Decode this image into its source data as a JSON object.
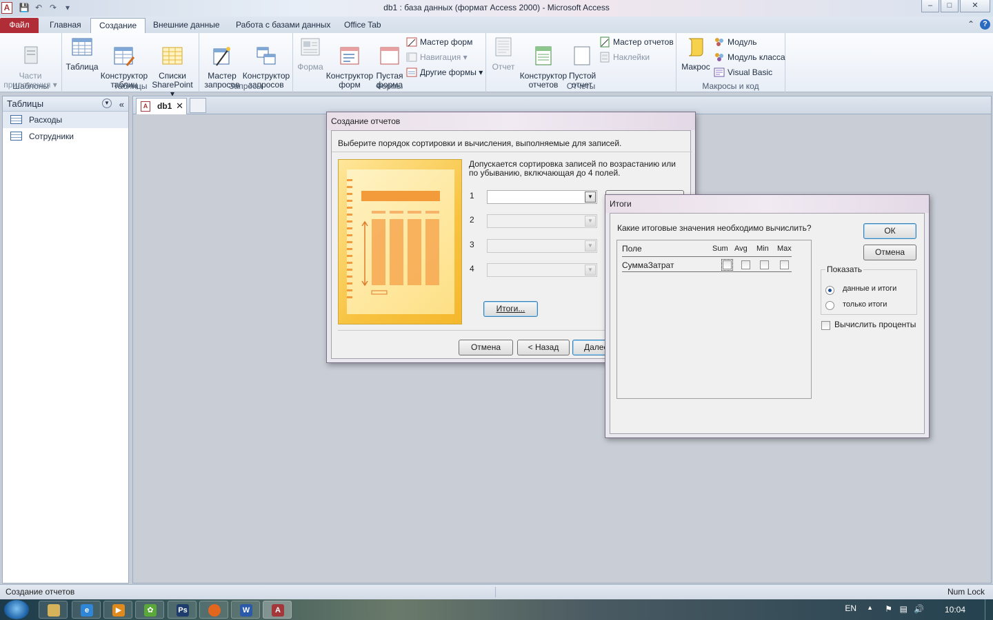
{
  "window": {
    "title": "db1 : база данных (формат Access 2000)  -  Microsoft Access"
  },
  "ribbon": {
    "tabs": [
      "Файл",
      "Главная",
      "Создание",
      "Внешние данные",
      "Работа с базами данных",
      "Office Tab"
    ],
    "groups": {
      "templates": {
        "label": "Шаблоны",
        "parts": "Части\nприложения"
      },
      "tables": {
        "label": "Таблицы",
        "table": "Таблица",
        "table_designer": "Конструктор\nтаблиц",
        "sharepoint": "Списки\nSharePoint"
      },
      "queries": {
        "label": "Запросы",
        "wizard": "Мастер\nзапросов",
        "designer": "Конструктор\nзапросов"
      },
      "forms": {
        "label": "Формы",
        "form": "Форма",
        "designer": "Конструктор\nформ",
        "blank": "Пустая\nформа",
        "wizard": "Мастер форм",
        "navigation": "Навигация",
        "other": "Другие формы"
      },
      "reports": {
        "label": "Отчеты",
        "report": "Отчет",
        "designer": "Конструктор\nотчетов",
        "blank": "Пустой\nотчет",
        "wizard": "Мастер отчетов",
        "labels": "Наклейки"
      },
      "macros": {
        "label": "Макросы и код",
        "macro": "Макрос",
        "module": "Модуль",
        "class_module": "Модуль класса",
        "vb": "Visual Basic"
      }
    }
  },
  "navpane": {
    "title": "Таблицы",
    "items": [
      {
        "label": "Расходы"
      },
      {
        "label": "Сотрудники"
      }
    ]
  },
  "doc_tab": {
    "label": "db1"
  },
  "wizard": {
    "title": "Создание отчетов",
    "instruction": "Выберите порядок сортировки и вычисления, выполняемые для записей.",
    "hint": "Допускается сортировка записей по возрастанию или по убыванию, включающая до 4 полей.",
    "rows": [
      "1",
      "2",
      "3",
      "4"
    ],
    "summary_button": "Итоги...",
    "cancel_button": "Отмена",
    "back_button": "< Назад",
    "next_button": "Далее"
  },
  "summary_dialog": {
    "title": "Итоги",
    "question": "Какие итоговые значения необходимо вычислить?",
    "columns": [
      "Поле",
      "Sum",
      "Avg",
      "Min",
      "Max"
    ],
    "rows": [
      {
        "field": "СуммаЗатрат"
      }
    ],
    "ok_button": "ОК",
    "cancel_button": "Отмена",
    "show_group": "Показать",
    "show_options": [
      "данные и итоги",
      "только итоги"
    ],
    "calc_percent": "Вычислить проценты"
  },
  "statusbar": {
    "left": "Создание отчетов",
    "right": "Num Lock"
  },
  "taskbar": {
    "lang": "EN",
    "time": "10:04"
  }
}
